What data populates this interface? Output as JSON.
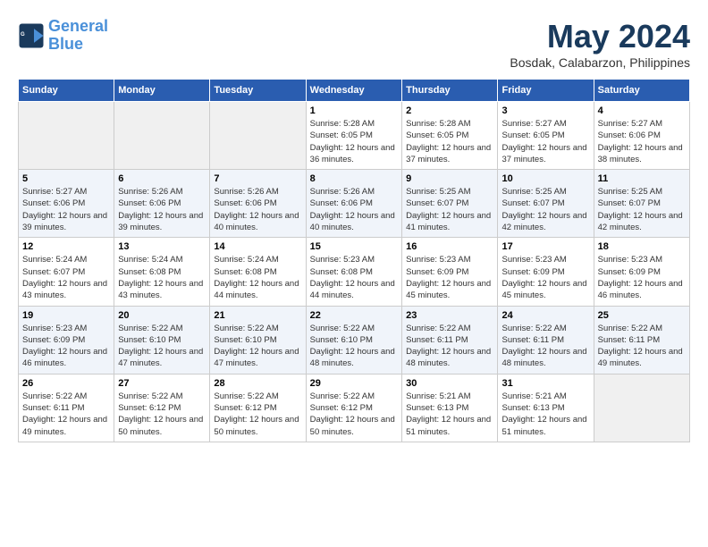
{
  "logo": {
    "line1": "General",
    "line2": "Blue"
  },
  "title": "May 2024",
  "location": "Bosdak, Calabarzon, Philippines",
  "weekdays": [
    "Sunday",
    "Monday",
    "Tuesday",
    "Wednesday",
    "Thursday",
    "Friday",
    "Saturday"
  ],
  "weeks": [
    [
      {
        "day": "",
        "sunrise": "",
        "sunset": "",
        "daylight": ""
      },
      {
        "day": "",
        "sunrise": "",
        "sunset": "",
        "daylight": ""
      },
      {
        "day": "",
        "sunrise": "",
        "sunset": "",
        "daylight": ""
      },
      {
        "day": "1",
        "sunrise": "Sunrise: 5:28 AM",
        "sunset": "Sunset: 6:05 PM",
        "daylight": "Daylight: 12 hours and 36 minutes."
      },
      {
        "day": "2",
        "sunrise": "Sunrise: 5:28 AM",
        "sunset": "Sunset: 6:05 PM",
        "daylight": "Daylight: 12 hours and 37 minutes."
      },
      {
        "day": "3",
        "sunrise": "Sunrise: 5:27 AM",
        "sunset": "Sunset: 6:05 PM",
        "daylight": "Daylight: 12 hours and 37 minutes."
      },
      {
        "day": "4",
        "sunrise": "Sunrise: 5:27 AM",
        "sunset": "Sunset: 6:06 PM",
        "daylight": "Daylight: 12 hours and 38 minutes."
      }
    ],
    [
      {
        "day": "5",
        "sunrise": "Sunrise: 5:27 AM",
        "sunset": "Sunset: 6:06 PM",
        "daylight": "Daylight: 12 hours and 39 minutes."
      },
      {
        "day": "6",
        "sunrise": "Sunrise: 5:26 AM",
        "sunset": "Sunset: 6:06 PM",
        "daylight": "Daylight: 12 hours and 39 minutes."
      },
      {
        "day": "7",
        "sunrise": "Sunrise: 5:26 AM",
        "sunset": "Sunset: 6:06 PM",
        "daylight": "Daylight: 12 hours and 40 minutes."
      },
      {
        "day": "8",
        "sunrise": "Sunrise: 5:26 AM",
        "sunset": "Sunset: 6:06 PM",
        "daylight": "Daylight: 12 hours and 40 minutes."
      },
      {
        "day": "9",
        "sunrise": "Sunrise: 5:25 AM",
        "sunset": "Sunset: 6:07 PM",
        "daylight": "Daylight: 12 hours and 41 minutes."
      },
      {
        "day": "10",
        "sunrise": "Sunrise: 5:25 AM",
        "sunset": "Sunset: 6:07 PM",
        "daylight": "Daylight: 12 hours and 42 minutes."
      },
      {
        "day": "11",
        "sunrise": "Sunrise: 5:25 AM",
        "sunset": "Sunset: 6:07 PM",
        "daylight": "Daylight: 12 hours and 42 minutes."
      }
    ],
    [
      {
        "day": "12",
        "sunrise": "Sunrise: 5:24 AM",
        "sunset": "Sunset: 6:07 PM",
        "daylight": "Daylight: 12 hours and 43 minutes."
      },
      {
        "day": "13",
        "sunrise": "Sunrise: 5:24 AM",
        "sunset": "Sunset: 6:08 PM",
        "daylight": "Daylight: 12 hours and 43 minutes."
      },
      {
        "day": "14",
        "sunrise": "Sunrise: 5:24 AM",
        "sunset": "Sunset: 6:08 PM",
        "daylight": "Daylight: 12 hours and 44 minutes."
      },
      {
        "day": "15",
        "sunrise": "Sunrise: 5:23 AM",
        "sunset": "Sunset: 6:08 PM",
        "daylight": "Daylight: 12 hours and 44 minutes."
      },
      {
        "day": "16",
        "sunrise": "Sunrise: 5:23 AM",
        "sunset": "Sunset: 6:09 PM",
        "daylight": "Daylight: 12 hours and 45 minutes."
      },
      {
        "day": "17",
        "sunrise": "Sunrise: 5:23 AM",
        "sunset": "Sunset: 6:09 PM",
        "daylight": "Daylight: 12 hours and 45 minutes."
      },
      {
        "day": "18",
        "sunrise": "Sunrise: 5:23 AM",
        "sunset": "Sunset: 6:09 PM",
        "daylight": "Daylight: 12 hours and 46 minutes."
      }
    ],
    [
      {
        "day": "19",
        "sunrise": "Sunrise: 5:23 AM",
        "sunset": "Sunset: 6:09 PM",
        "daylight": "Daylight: 12 hours and 46 minutes."
      },
      {
        "day": "20",
        "sunrise": "Sunrise: 5:22 AM",
        "sunset": "Sunset: 6:10 PM",
        "daylight": "Daylight: 12 hours and 47 minutes."
      },
      {
        "day": "21",
        "sunrise": "Sunrise: 5:22 AM",
        "sunset": "Sunset: 6:10 PM",
        "daylight": "Daylight: 12 hours and 47 minutes."
      },
      {
        "day": "22",
        "sunrise": "Sunrise: 5:22 AM",
        "sunset": "Sunset: 6:10 PM",
        "daylight": "Daylight: 12 hours and 48 minutes."
      },
      {
        "day": "23",
        "sunrise": "Sunrise: 5:22 AM",
        "sunset": "Sunset: 6:11 PM",
        "daylight": "Daylight: 12 hours and 48 minutes."
      },
      {
        "day": "24",
        "sunrise": "Sunrise: 5:22 AM",
        "sunset": "Sunset: 6:11 PM",
        "daylight": "Daylight: 12 hours and 48 minutes."
      },
      {
        "day": "25",
        "sunrise": "Sunrise: 5:22 AM",
        "sunset": "Sunset: 6:11 PM",
        "daylight": "Daylight: 12 hours and 49 minutes."
      }
    ],
    [
      {
        "day": "26",
        "sunrise": "Sunrise: 5:22 AM",
        "sunset": "Sunset: 6:11 PM",
        "daylight": "Daylight: 12 hours and 49 minutes."
      },
      {
        "day": "27",
        "sunrise": "Sunrise: 5:22 AM",
        "sunset": "Sunset: 6:12 PM",
        "daylight": "Daylight: 12 hours and 50 minutes."
      },
      {
        "day": "28",
        "sunrise": "Sunrise: 5:22 AM",
        "sunset": "Sunset: 6:12 PM",
        "daylight": "Daylight: 12 hours and 50 minutes."
      },
      {
        "day": "29",
        "sunrise": "Sunrise: 5:22 AM",
        "sunset": "Sunset: 6:12 PM",
        "daylight": "Daylight: 12 hours and 50 minutes."
      },
      {
        "day": "30",
        "sunrise": "Sunrise: 5:21 AM",
        "sunset": "Sunset: 6:13 PM",
        "daylight": "Daylight: 12 hours and 51 minutes."
      },
      {
        "day": "31",
        "sunrise": "Sunrise: 5:21 AM",
        "sunset": "Sunset: 6:13 PM",
        "daylight": "Daylight: 12 hours and 51 minutes."
      },
      {
        "day": "",
        "sunrise": "",
        "sunset": "",
        "daylight": ""
      }
    ]
  ]
}
